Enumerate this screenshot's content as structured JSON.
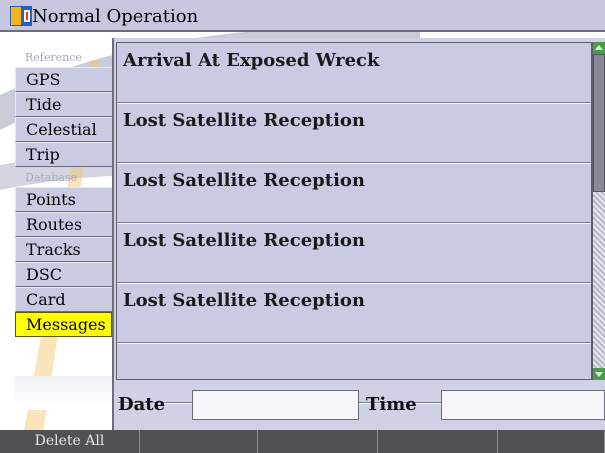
{
  "window": {
    "title": "Normal Operation",
    "icon": "garmin-app-icon"
  },
  "sidebar": {
    "sections": [
      {
        "header": "Reference",
        "items": [
          "GPS",
          "Tide",
          "Celestial",
          "Trip"
        ]
      },
      {
        "header": "Database",
        "items": [
          "Points",
          "Routes",
          "Tracks",
          "DSC",
          "Card",
          "Messages"
        ]
      }
    ],
    "active_item": "Messages"
  },
  "messages": [
    {
      "text": "Arrival At Exposed Wreck"
    },
    {
      "text": "Lost Satellite Reception"
    },
    {
      "text": "Lost Satellite Reception"
    },
    {
      "text": "Lost Satellite Reception"
    },
    {
      "text": "Lost Satellite Reception"
    },
    {
      "text": ""
    }
  ],
  "details": {
    "date_label": "Date",
    "date_value": "",
    "time_label": "Time",
    "time_value": ""
  },
  "softkeys": [
    "Delete All",
    "",
    "",
    "",
    ""
  ],
  "colors": {
    "active_tab": "#ffff00",
    "panel": "#c9cbe2",
    "softkey_bar": "#4a4a4f"
  }
}
